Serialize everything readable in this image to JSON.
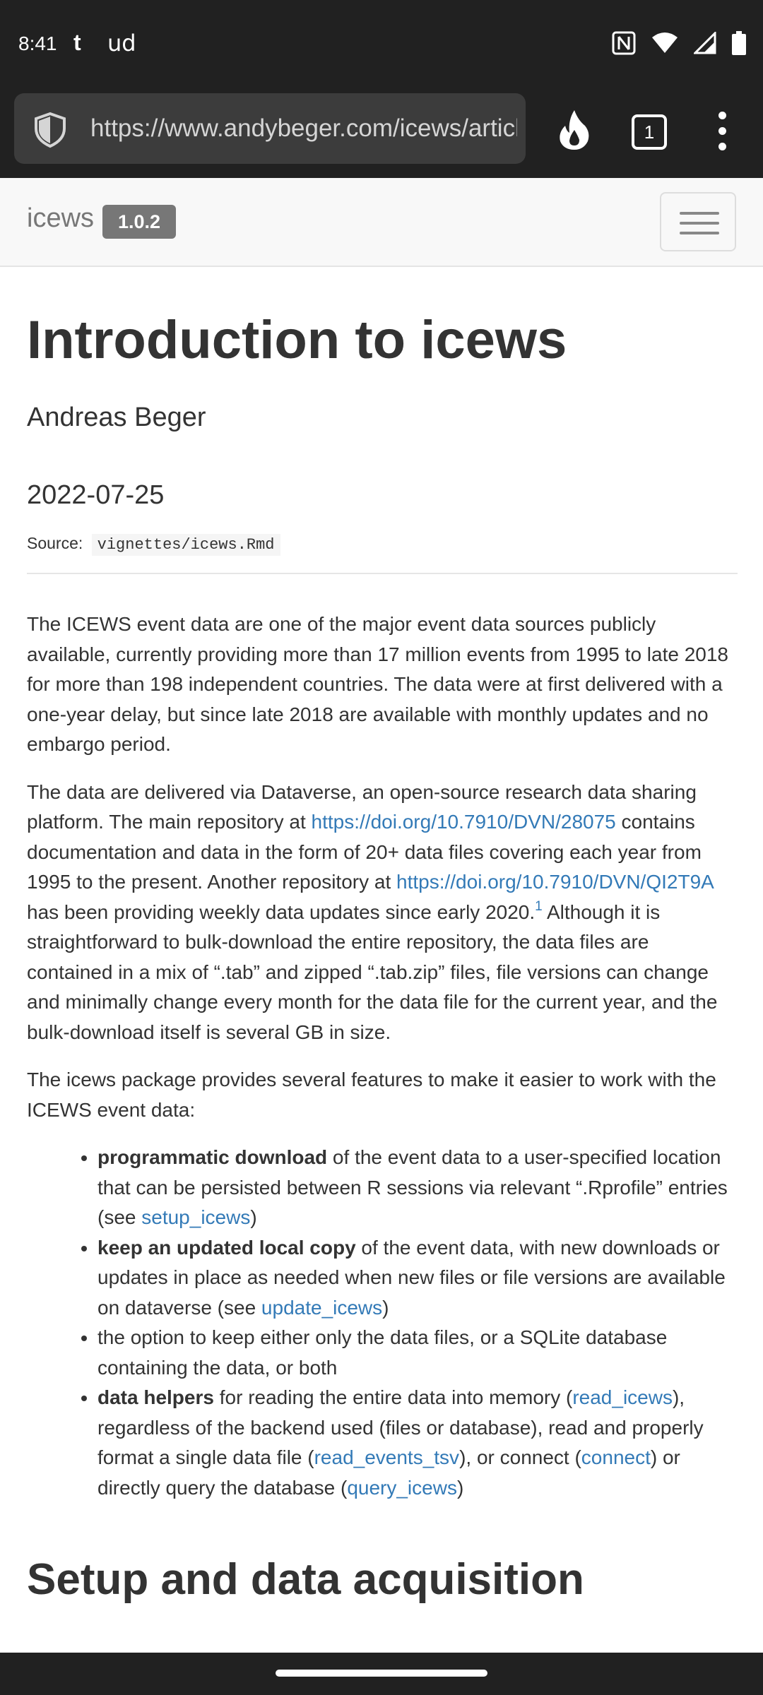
{
  "status_bar": {
    "time": "8:41",
    "app_icon_1": "t",
    "app_icon_2": "ud",
    "icons": [
      "nfc-icon",
      "wifi-icon",
      "signal-icon",
      "battery-icon"
    ]
  },
  "browser": {
    "url": "https://www.andybeger.com/icews/articles/icews.html",
    "tab_count": "1",
    "icons": [
      "shield-icon",
      "fire-icon",
      "tabs-icon",
      "more-icon"
    ]
  },
  "site_nav": {
    "brand": "icews",
    "version": "1.0.2"
  },
  "article": {
    "title": "Introduction to icews",
    "author": "Andreas Beger",
    "date": "2022-07-25",
    "source_label": "Source:",
    "source_path": "vignettes/icews.Rmd",
    "p1": "The ICEWS event data are one of the major event data sources publicly available, currently providing more than 17 million events from 1995 to late 2018 for more than 198 independent countries. The data were at first delivered with a one-year delay, but since late 2018 are available with monthly updates and no embargo period.",
    "p2": {
      "t1": "The data are delivered via Dataverse, an open-source research data sharing platform. The main repository at ",
      "link1": "https://doi.org/10.7910/DVN/28075",
      "t2": " contains documentation and data in the form of 20+ data files covering each year from 1995 to the present. Another repository at ",
      "link2": "https://doi.org/10.7910/DVN/QI2T9A",
      "t3": " has been providing weekly data updates since early 2020.",
      "footnote": "1",
      "t4": " Although it is straightforward to bulk-download the entire repository, the data files are contained in a mix of “.tab” and zipped “.tab.zip” files, file versions can change and minimally change every month for the data file for the current year, and the bulk-download itself is several GB in size."
    },
    "p3": "The icews package provides several features to make it easier to work with the ICEWS event data:",
    "features": {
      "f1": {
        "bold": "programmatic download",
        "text": " of the event data to a user-specified location that can be persisted between R sessions via relevant “.Rprofile” entries (see ",
        "link": "setup_icews",
        "end": ")"
      },
      "f2": {
        "bold": "keep an updated local copy",
        "text": " of the event data, with new downloads or updates in place as needed when new files or file versions are available on dataverse (see ",
        "link": "update_icews",
        "end": ")"
      },
      "f3": {
        "text": "the option to keep either only the data files, or a SQLite database containing the data, or both"
      },
      "f4": {
        "bold": "data helpers",
        "t1": " for reading the entire data into memory (",
        "link1": "read_icews",
        "t2": "), regardless of the backend used (files or database), read and properly format a single data file (",
        "link2": "read_events_tsv",
        "t3": "), or connect (",
        "link3": "connect",
        "t4": ") or directly query the database (",
        "link4": "query_icews",
        "t5": ")"
      }
    },
    "next_heading": "Setup and data acquisition"
  }
}
